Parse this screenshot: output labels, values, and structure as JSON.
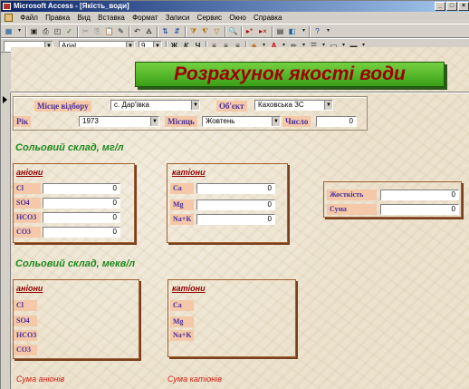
{
  "window": {
    "title": "Microsoft Access - [Якість_води]"
  },
  "menu": [
    "Файл",
    "Правка",
    "Вид",
    "Вставка",
    "Формат",
    "Записи",
    "Сервис",
    "Окно",
    "Справка"
  ],
  "toolbar": {
    "font_name": "Arial",
    "font_size": "9"
  },
  "form": {
    "title": "Розрахунок якості води",
    "fields": {
      "sampling_place": {
        "label": "Місце відбору",
        "value": "с. Дар'ївка"
      },
      "object": {
        "label": "Об'єкт",
        "value": "Каховська ЗС"
      },
      "year": {
        "label": "Рік",
        "value": "1973"
      },
      "month": {
        "label": "Місяць",
        "value": "Жовтень"
      },
      "day": {
        "label": "Число",
        "value": "0"
      }
    },
    "section1": {
      "title": "Сольовий склад, мг/л",
      "anions": {
        "title": "аніони",
        "rows": [
          {
            "label": "Cl",
            "value": "0"
          },
          {
            "label": "SO4",
            "value": "0"
          },
          {
            "label": "HCO3",
            "value": "0"
          },
          {
            "label": "CO3",
            "value": "0"
          }
        ]
      },
      "cations": {
        "title": "катіони",
        "rows": [
          {
            "label": "Ca",
            "value": "0"
          },
          {
            "label": "Mg",
            "value": "0"
          },
          {
            "label": "Na+K",
            "value": "0"
          }
        ]
      },
      "totals": [
        {
          "label": "Жосткість",
          "value": "0"
        },
        {
          "label": "Сума",
          "value": "0"
        }
      ]
    },
    "section2": {
      "title": "Сольовий склад, мекв/л",
      "anions": {
        "title": "аніони",
        "rows": [
          "Cl",
          "SO4",
          "HCO3",
          "CO3"
        ]
      },
      "cations": {
        "title": "катіони",
        "rows": [
          "Ca",
          "Mg",
          "Na+K"
        ]
      },
      "sum_anions": "Сума аніонів",
      "sum_cations": "Сума катіонів"
    }
  },
  "colors": {
    "title_bar": "#0a246a",
    "form_title_text": "#a00000",
    "form_title_bg": "#5cc030",
    "section_title": "#1c8a1c",
    "label_text": "#4a2f9a",
    "label_bg": "#f4c8a8",
    "group_border": "#a06030"
  }
}
